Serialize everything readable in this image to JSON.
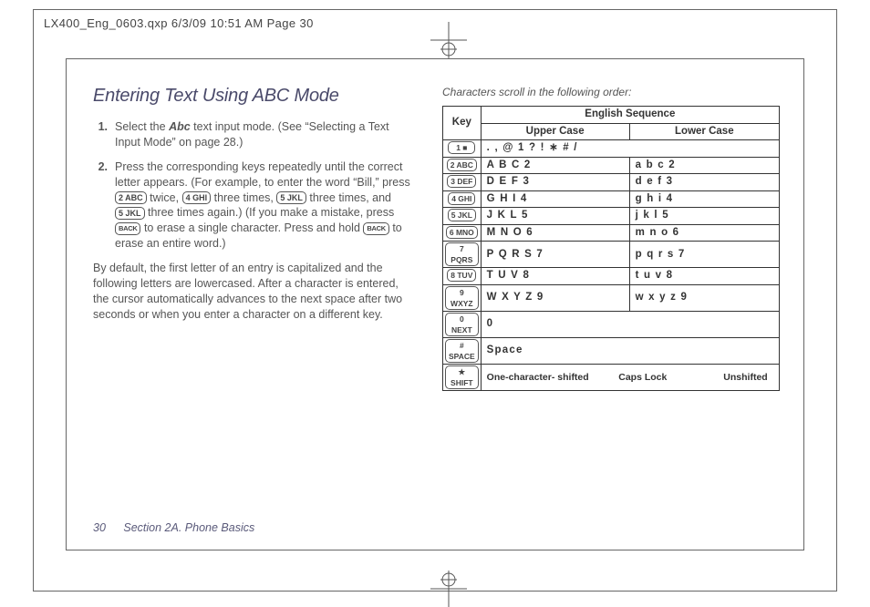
{
  "slug": "LX400_Eng_0603.qxp  6/3/09  10:51 AM  Page 30",
  "heading": "Entering Text Using ABC Mode",
  "step1_num": "1.",
  "step1_a": "Select the ",
  "step1_abc": "Abc",
  "step1_b": " text input mode. (See “Selecting a Text Input Mode” on page 28.)",
  "step2_num": "2.",
  "step2_a": "Press the corresponding keys repeatedly until the correct letter appears. (For example, to enter the word “Bill,” press ",
  "step2_b": " twice, ",
  "step2_c": " three times, ",
  "step2_d": " three times, and ",
  "step2_e": " three times again.) (If you make a mistake, press ",
  "step2_f": " to erase a single character. Press and hold ",
  "step2_g": " to erase an entire word.)",
  "key2": "2 ABC",
  "key4": "4 GHI",
  "key5": "5 JKL",
  "keyback": "BACK",
  "para": "By default, the first letter of an entry is capitalized and the following letters are lowercased. After a character is entered, the cursor automatically advances to the next space after two seconds or when you enter a character on a different key.",
  "table_caption": "Characters scroll in the following order:",
  "th_key": "Key",
  "th_seq": "English Sequence",
  "th_upper": "Upper Case",
  "th_lower": "Lower Case",
  "rows": [
    {
      "key": "1 ■",
      "upper": ". , @ 1 ? ! ∗ # /",
      "lower": ""
    },
    {
      "key": "2 ABC",
      "upper": "A B C 2",
      "lower": "a b c 2"
    },
    {
      "key": "3 DEF",
      "upper": "D E F 3",
      "lower": "d e f 3"
    },
    {
      "key": "4 GHI",
      "upper": "G H I 4",
      "lower": "g h i 4"
    },
    {
      "key": "5 JKL",
      "upper": "J K L 5",
      "lower": "j k l 5"
    },
    {
      "key": "6 MNO",
      "upper": "M N O 6",
      "lower": "m n o 6"
    },
    {
      "key": "7 PQRS",
      "upper": "P Q R S 7",
      "lower": "p q r s 7"
    },
    {
      "key": "8 TUV",
      "upper": "T U V 8",
      "lower": "t u v 8"
    },
    {
      "key": "9 WXYZ",
      "upper": "W X Y Z 9",
      "lower": "w x y z 9"
    },
    {
      "key": "0 NEXT",
      "upper": "0",
      "lower": ""
    },
    {
      "key": "# SPACE",
      "upper": "Space",
      "lower": ""
    }
  ],
  "star_key": "★ SHIFT",
  "star_a": "One-character- shifted",
  "star_b": "Caps Lock",
  "star_c": "Unshifted",
  "footer_page": "30",
  "footer_section": "Section 2A. Phone Basics"
}
